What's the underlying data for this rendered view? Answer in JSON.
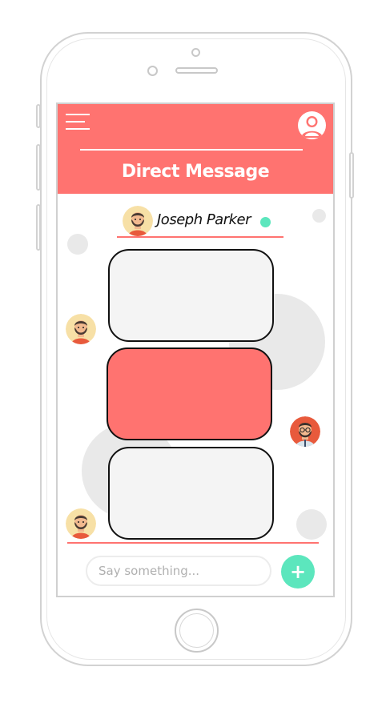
{
  "header": {
    "title": "Direct Message",
    "menu_icon": "hamburger-menu-icon",
    "profile_icon": "user-profile-icon",
    "background_color": "#ff7370"
  },
  "contact": {
    "name": "Joseph Parker",
    "status": "online",
    "status_color": "#5ce6bd",
    "avatar_icon": "bearded-man-avatar"
  },
  "messages": [
    {
      "from": "contact",
      "text": "",
      "avatar_icon": "bearded-man-avatar",
      "bubble_color": "#f4f4f4"
    },
    {
      "from": "me",
      "text": "",
      "avatar_icon": "glasses-man-avatar",
      "bubble_color": "#ff7370"
    },
    {
      "from": "contact",
      "text": "",
      "avatar_icon": "bearded-man-avatar",
      "bubble_color": "#f4f4f4"
    }
  ],
  "composer": {
    "placeholder": "Say something...",
    "send_label": "+",
    "send_color": "#5ce6bd"
  }
}
